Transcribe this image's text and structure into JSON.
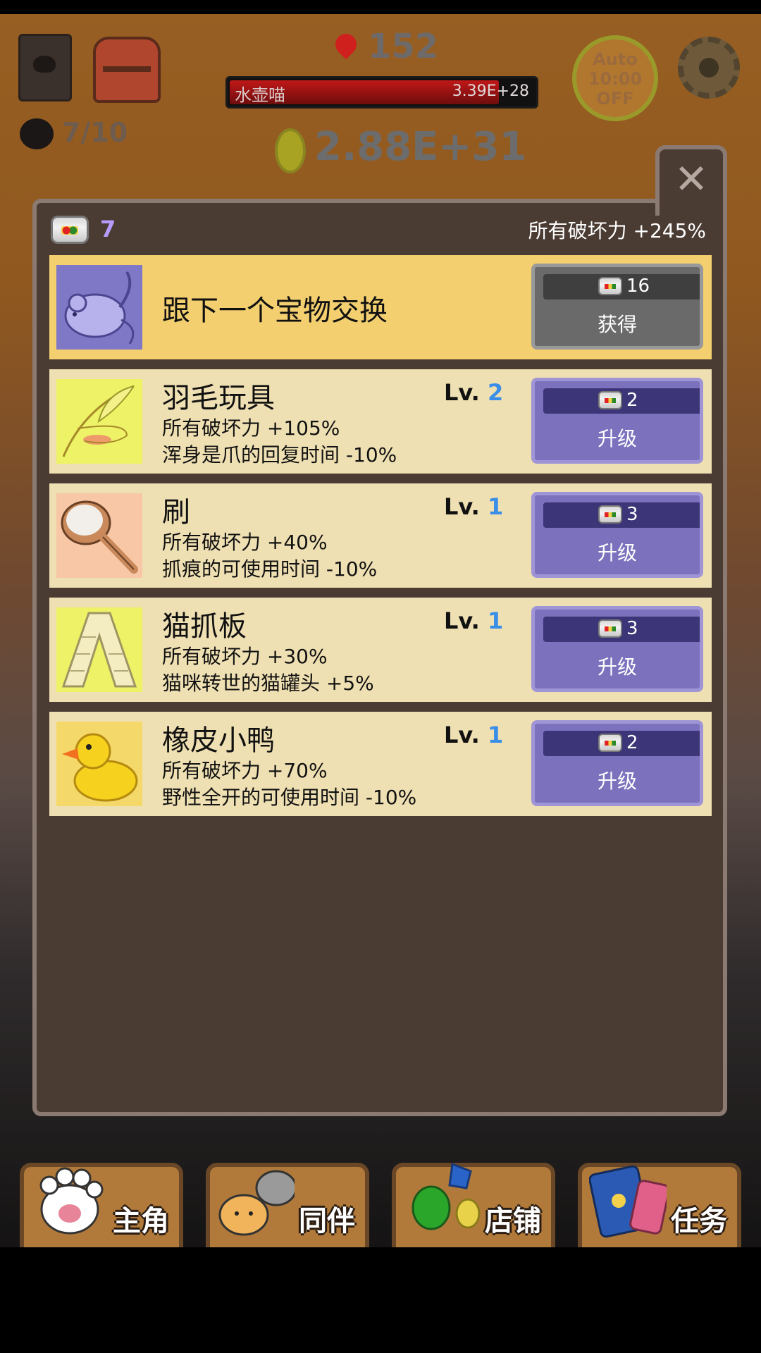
{
  "hud": {
    "stage": "152",
    "boss_name": "水壶喵",
    "boss_hp": "3.39E+28",
    "auto_line1": "Auto",
    "auto_line2": "10:00",
    "auto_line3": "OFF",
    "cat_count": "7/10",
    "gold": "2.88E+31"
  },
  "panel": {
    "can_count": "7",
    "total_bonus": "所有破坏力 +245%",
    "close_icon": "close-icon",
    "special": {
      "name": "跟下一个宝物交换",
      "cost": "16",
      "button": "获得"
    },
    "items": [
      {
        "name": "羽毛玩具",
        "lv_prefix": "Lv.",
        "lv": "2",
        "desc1": "所有破坏力 +105%",
        "desc2": "浑身是爪的回复时间 -10%",
        "cost": "2",
        "button": "升级"
      },
      {
        "name": "刷",
        "lv_prefix": "Lv.",
        "lv": "1",
        "desc1": "所有破坏力 +40%",
        "desc2": "抓痕的可使用时间 -10%",
        "cost": "3",
        "button": "升级"
      },
      {
        "name": "猫抓板",
        "lv_prefix": "Lv.",
        "lv": "1",
        "desc1": "所有破坏力 +30%",
        "desc2": "猫咪转世的猫罐头 +5%",
        "cost": "3",
        "button": "升级"
      },
      {
        "name": "橡皮小鸭",
        "lv_prefix": "Lv.",
        "lv": "1",
        "desc1": "所有破坏力 +70%",
        "desc2": "野性全开的可使用时间 -10%",
        "cost": "2",
        "button": "升级"
      }
    ]
  },
  "nav": {
    "hero": "主角",
    "companion": "同伴",
    "shop": "店铺",
    "quest": "任务"
  },
  "colors": {
    "accent_level": "#3a8ee8",
    "upgrade_button": "#7b71bd",
    "get_button": "#6a6a6a",
    "panel_bg": "#4a3b33",
    "row_bg": "#efe0b3",
    "special_row_bg": "#f3cf70"
  }
}
